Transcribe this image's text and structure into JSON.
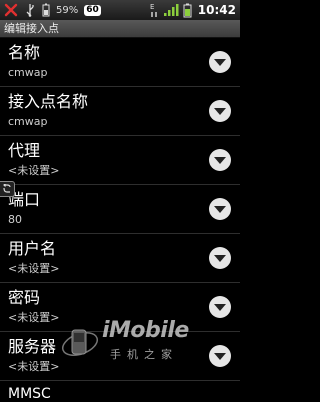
{
  "status_bar": {
    "battery_percent": "59%",
    "battery_badge": "60",
    "time": "10:42",
    "icons": [
      "usb-debug-icon",
      "usb-connected-icon",
      "battery-icon",
      "signal-edge-icon",
      "signal-bars-icon",
      "battery-level-icon"
    ]
  },
  "header": {
    "title": "编辑接入点"
  },
  "fields": [
    {
      "title": "名称",
      "value": "cmwap"
    },
    {
      "title": "接入点名称",
      "value": "cmwap"
    },
    {
      "title": "代理",
      "value": "<未设置>"
    },
    {
      "title": "端口",
      "value": "80"
    },
    {
      "title": "用户名",
      "value": "<未设置>"
    },
    {
      "title": "密码",
      "value": "<未设置>"
    },
    {
      "title": "服务器",
      "value": "<未设置>"
    }
  ],
  "partial_row": {
    "title": "MMSC"
  },
  "watermark": {
    "brand": "iMobile",
    "subtitle": "手机之家"
  },
  "colors": {
    "background": "#000000",
    "title_bar": "#4a4a4a",
    "dropdown_button": "#e6e6e6"
  }
}
